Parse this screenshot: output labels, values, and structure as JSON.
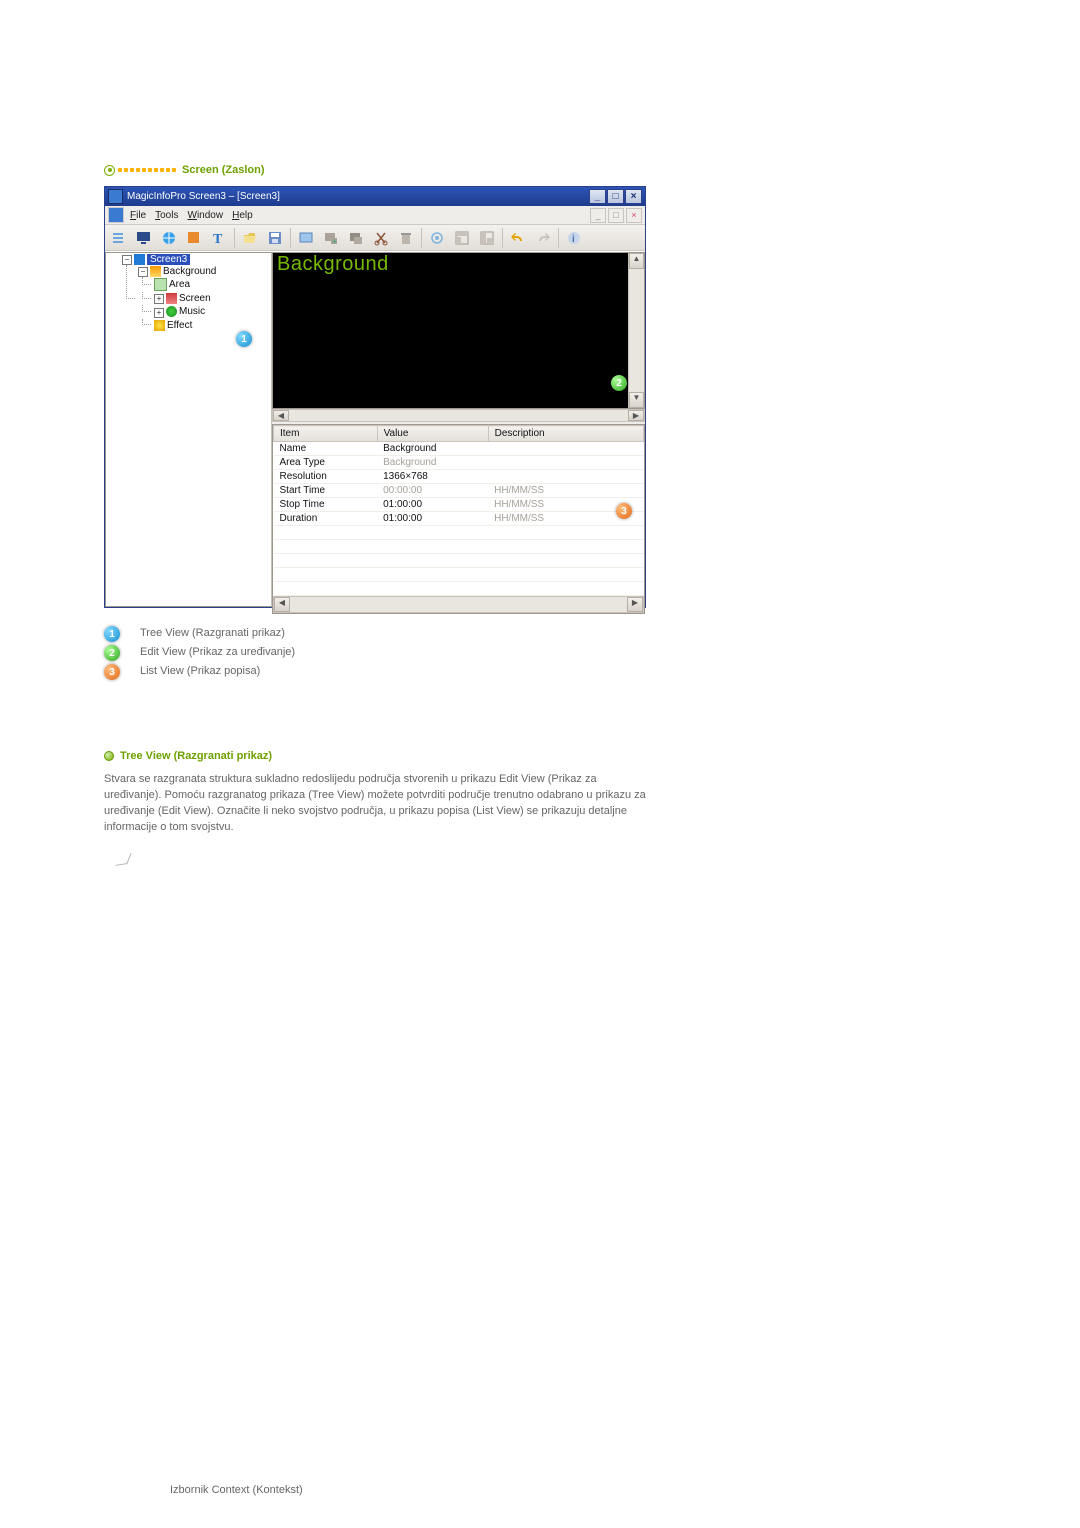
{
  "section1": {
    "title": "Screen (Zaslon)"
  },
  "callouts": {
    "c1": "1",
    "c2": "2",
    "c3": "3"
  },
  "app": {
    "title": "MagicInfoPro Screen3 – [Screen3]",
    "menu": {
      "file": "File",
      "tools": "Tools",
      "window": "Window",
      "help": "Help"
    },
    "tree": {
      "root": "Screen3",
      "items": [
        "Background",
        "Area",
        "Screen",
        "Music",
        "Effect"
      ]
    },
    "edit": {
      "label": "Background"
    },
    "list": {
      "headers": {
        "item": "Item",
        "value": "Value",
        "desc": "Description"
      },
      "rows": [
        {
          "item": "Name",
          "value": "Background",
          "desc": ""
        },
        {
          "item": "Area Type",
          "value": "Background",
          "desc": "",
          "gray": true
        },
        {
          "item": "Resolution",
          "value": "1366×768",
          "desc": ""
        },
        {
          "item": "Start Time",
          "value": "00:00:00",
          "desc": "HH/MM/SS",
          "gray": true
        },
        {
          "item": "Stop Time",
          "value": "01:00:00",
          "desc": "HH/MM/SS"
        },
        {
          "item": "Duration",
          "value": "01:00:00",
          "desc": "HH/MM/SS"
        }
      ]
    }
  },
  "legend": {
    "l1": "Tree View (Razgranati prikaz)",
    "l2": "Edit View (Prikaz za uređivanje)",
    "l3": "List View (Prikaz popisa)"
  },
  "section2": {
    "title": "Tree View (Razgranati prikaz)",
    "para": "Stvara se razgranata struktura sukladno redoslijedu područja stvorenih u prikazu Edit View (Prikaz za uređivanje). Pomoću razgranatog prikaza (Tree View) možete potvrditi područje trenutno odabrano u prikazu za uređivanje (Edit View). Označite li neko svojstvo područja, u prikazu popisa (List View) se prikazuju detaljne informacije o tom svojstvu."
  },
  "footer": "Izbornik Context (Kontekst)"
}
